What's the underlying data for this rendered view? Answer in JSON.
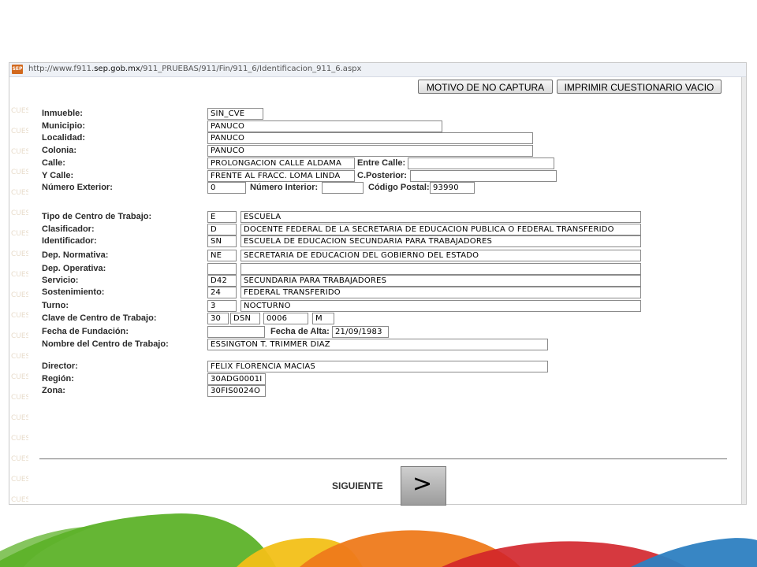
{
  "browser": {
    "favicon_text": "SEP",
    "url_prefix": "http://www.f911.",
    "url_domain": "sep.gob.mx",
    "url_path": "/911_PRUEBAS/911/Fin/911_6/Identificacion_911_6.aspx"
  },
  "toolbar": {
    "motivo_label": "MOTIVO DE NO CAPTURA",
    "imprimir_label": "IMPRIMIR CUESTIONARIO VACIO"
  },
  "watermark_text": "CUEST",
  "labels": {
    "inmueble": "Inmueble:",
    "municipio": "Municipio:",
    "localidad": "Localidad:",
    "colonia": "Colonia:",
    "calle": "Calle:",
    "entre_calle": "Entre Calle:",
    "y_calle": "Y Calle:",
    "c_posterior": "C.Posterior:",
    "numero_exterior": "Número Exterior:",
    "numero_interior": "Número Interior:",
    "codigo_postal": "Código Postal:",
    "tipo_centro": "Tipo de Centro de Trabajo:",
    "clasificador": "Clasificador:",
    "identificador": "Identificador:",
    "dep_normativa": "Dep. Normativa:",
    "dep_operativa": "Dep. Operativa:",
    "servicio": "Servicio:",
    "sostenimiento": "Sostenimiento:",
    "turno": "Turno:",
    "clave_centro": "Clave de Centro de Trabajo:",
    "fecha_fundacion": "Fecha de Fundación:",
    "fecha_alta": "Fecha de Alta:",
    "nombre_centro": "Nombre del Centro de Trabajo:",
    "director": "Director:",
    "region": "Región:",
    "zona": "Zona:"
  },
  "values": {
    "inmueble": "SIN_CVE",
    "municipio": "PANUCO",
    "localidad": "PANUCO",
    "colonia": "PANUCO",
    "calle": "PROLONGACION CALLE ALDAMA",
    "entre_calle": "",
    "y_calle": "FRENTE AL FRACC. LOMA LINDA",
    "c_posterior": "",
    "numero_exterior": "0",
    "numero_interior": "",
    "codigo_postal": "93990",
    "tipo_code": "E",
    "tipo_desc": "ESCUELA",
    "clasificador_code": "D",
    "clasificador_desc": "DOCENTE FEDERAL DE LA SECRETARIA DE EDUCACION PUBLICA O FEDERAL TRANSFERIDO",
    "identificador_code": "SN",
    "identificador_desc": "ESCUELA DE EDUCACION SECUNDARIA PARA TRABAJADORES",
    "dep_normativa_code": "NE",
    "dep_normativa_desc": "SECRETARIA DE EDUCACION DEL GOBIERNO DEL ESTADO",
    "dep_operativa_code": "",
    "dep_operativa_desc": "",
    "servicio_code": "D42",
    "servicio_desc": "SECUNDARIA PARA TRABAJADORES",
    "sostenimiento_code": "24",
    "sostenimiento_desc": "FEDERAL TRANSFERIDO",
    "turno_code": "3",
    "turno_desc": "NOCTURNO",
    "clave_1": "30",
    "clave_2": "DSN",
    "clave_3": "0006",
    "clave_4": "M",
    "fecha_fundacion": "",
    "fecha_alta": "21/09/1983",
    "nombre_centro": "ESSINGTON T. TRIMMER DIAZ",
    "director": "FELIX FLORENCIA MACIAS",
    "region": "30ADG0001I",
    "zona": "30FIS0024O"
  },
  "siguiente": {
    "label": "SIGUIENTE",
    "icon_glyph": ">"
  },
  "colors": {
    "band_green": "#5db229",
    "band_yellow": "#f2c018",
    "band_orange": "#ee7a1b",
    "band_red": "#d2232a",
    "band_blue": "#2d7fc1"
  }
}
